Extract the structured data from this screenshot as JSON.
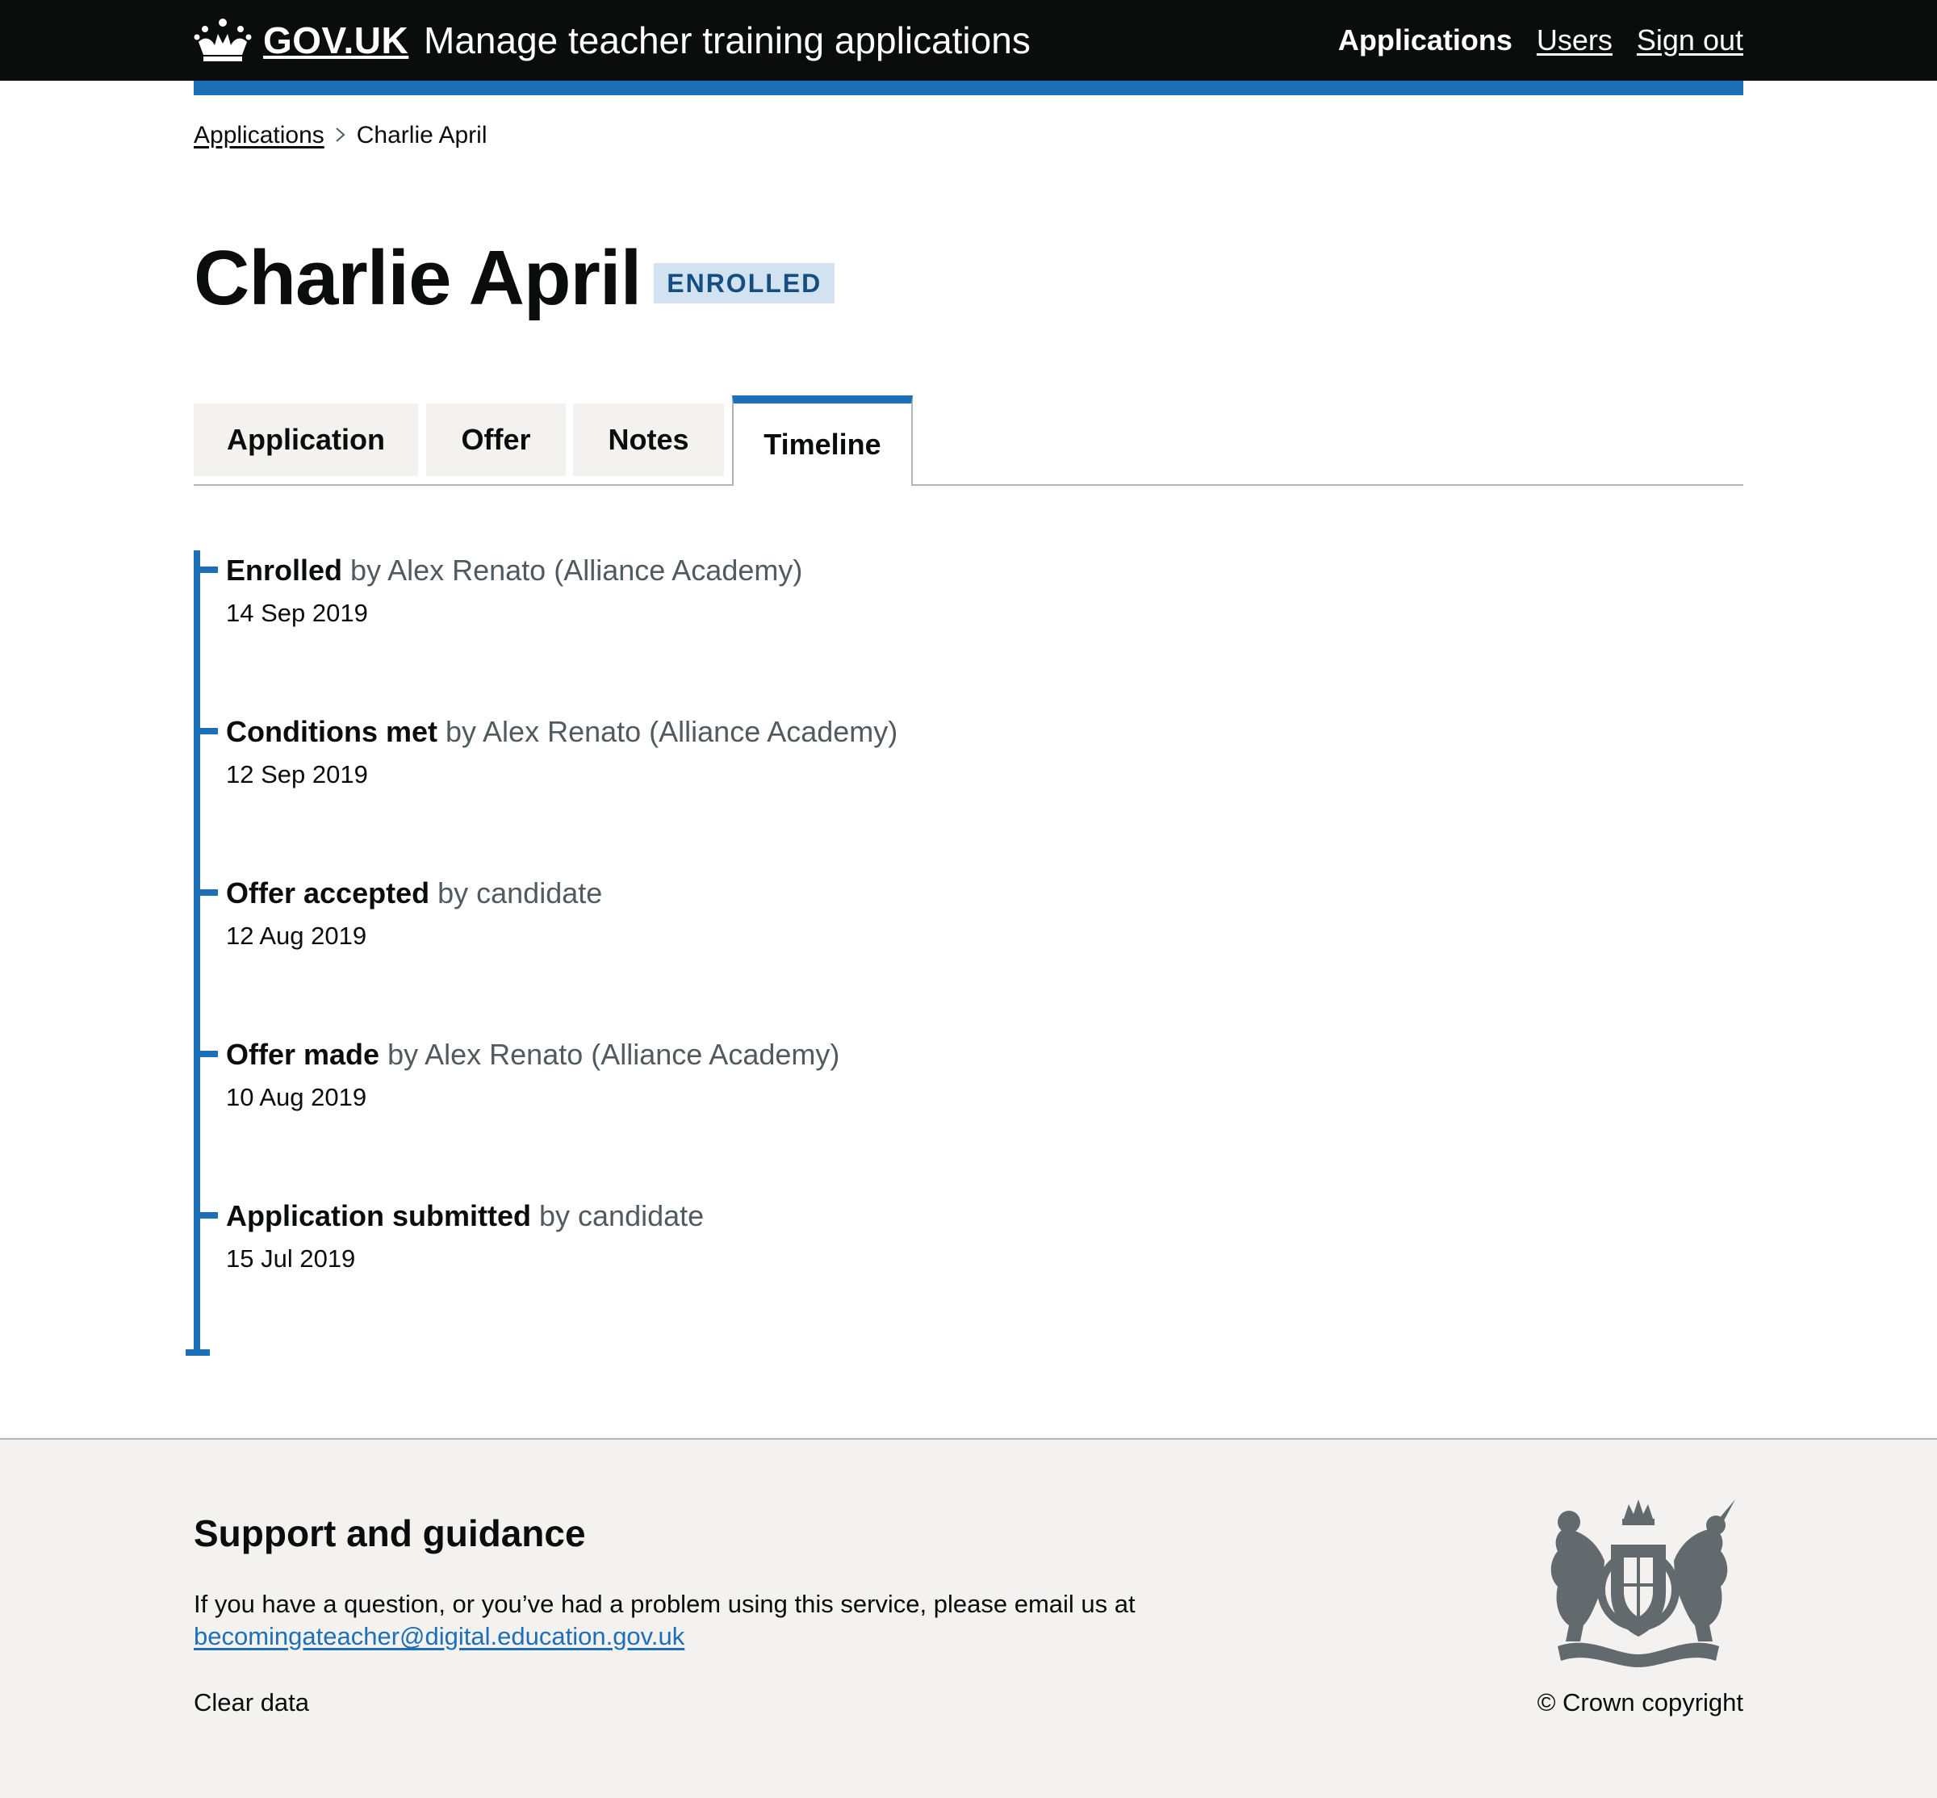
{
  "header": {
    "logo_text": "GOV.UK",
    "logo_icon": "crown-icon",
    "service_name": "Manage teacher training applications",
    "nav": {
      "applications": "Applications",
      "users": "Users",
      "sign_out": "Sign out"
    }
  },
  "breadcrumb": {
    "parent": "Applications",
    "current": "Charlie April"
  },
  "page": {
    "title": "Charlie April",
    "status": "ENROLLED"
  },
  "tabs": {
    "application": "Application",
    "offer": "Offer",
    "notes": "Notes",
    "timeline": "Timeline",
    "selected": "Timeline"
  },
  "timeline": {
    "items": [
      {
        "event": "Enrolled",
        "actor": "by Alex Renato (Alliance Academy)",
        "date": "14 Sep 2019"
      },
      {
        "event": "Conditions met",
        "actor": "by Alex Renato (Alliance Academy)",
        "date": "12 Sep 2019"
      },
      {
        "event": "Offer accepted",
        "actor": "by candidate",
        "date": "12 Aug 2019"
      },
      {
        "event": "Offer made",
        "actor": "by Alex Renato (Alliance Academy)",
        "date": "10 Aug 2019"
      },
      {
        "event": "Application submitted",
        "actor": "by candidate",
        "date": "15 Jul 2019"
      }
    ]
  },
  "footer": {
    "heading": "Support and guidance",
    "text": "If you have a question, or you’ve had a problem using this service, please email us at",
    "email": "becomingateacher@digital.education.gov.uk",
    "clear_data": "Clear data",
    "copyright": "© Crown copyright",
    "crest_icon": "royal-coat-of-arms-icon"
  },
  "colors": {
    "header_bg": "#0b0c0c",
    "brand_blue": "#1d70b8",
    "badge_bg": "#d2e2f1",
    "badge_text": "#144e81",
    "secondary_text": "#505a5f",
    "footer_bg": "#f3f2f1"
  }
}
